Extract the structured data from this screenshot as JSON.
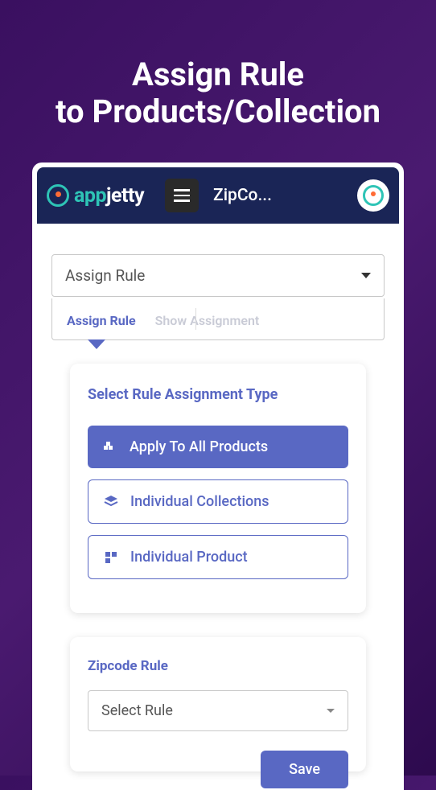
{
  "hero": {
    "line1": "Assign Rule",
    "line2": "to Products/Collection"
  },
  "header": {
    "logo_first": "app",
    "logo_second": "jetty",
    "title": "ZipCo..."
  },
  "dropdown": {
    "label": "Assign Rule"
  },
  "tabs": {
    "assign": "Assign Rule",
    "show": "Show Assignment"
  },
  "assignment_card": {
    "title": "Select Rule Assignment Type",
    "options": {
      "all": "Apply To All Products",
      "collections": "Individual Collections",
      "product": "Individual Product"
    }
  },
  "zipcode_card": {
    "title": "Zipcode Rule",
    "select_placeholder": "Select Rule",
    "save_label": "Save"
  }
}
